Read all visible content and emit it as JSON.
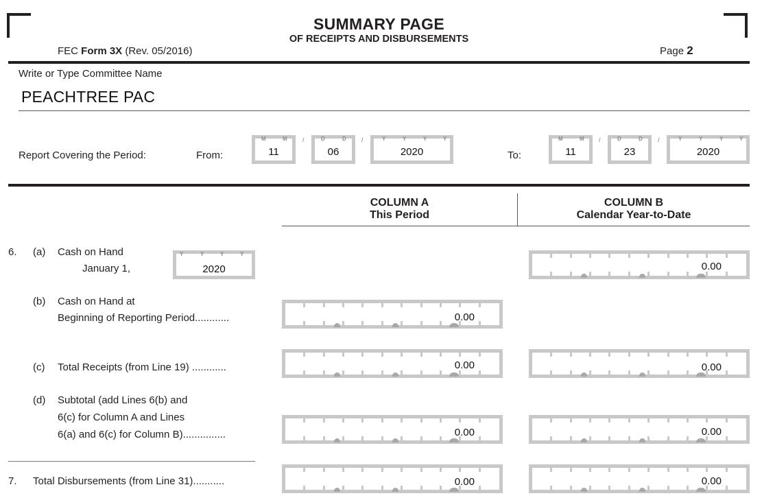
{
  "header": {
    "title": "SUMMARY PAGE",
    "subtitle": "OF RECEIPTS AND DISBURSEMENTS",
    "form_prefix": "FEC",
    "form_name": "Form 3X",
    "form_rev": "(Rev. 05/2016)",
    "page_label": "Page",
    "page_number": "2"
  },
  "committee": {
    "label": "Write or Type Committee Name",
    "name": "PEACHTREE PAC"
  },
  "period": {
    "label": "Report Covering the Period:",
    "from_label": "From:",
    "to_label": "To:",
    "from": {
      "month": "11",
      "day": "06",
      "year": "2020"
    },
    "to": {
      "month": "11",
      "day": "23",
      "year": "2020"
    },
    "hints": {
      "month": [
        "M",
        "M"
      ],
      "day": [
        "D",
        "D"
      ],
      "year": [
        "Y",
        "Y",
        "Y",
        "Y"
      ],
      "separator": "/"
    }
  },
  "columns": {
    "a": {
      "title": "COLUMN A",
      "subtitle": "This Period"
    },
    "b": {
      "title": "COLUMN B",
      "subtitle": "Calendar Year-to-Date"
    }
  },
  "lines": {
    "l6_number": "6.",
    "l6a": {
      "letter": "(a)",
      "text1": "Cash on Hand",
      "text2": "January 1,",
      "year": "2020",
      "col_b": "0.00"
    },
    "l6b": {
      "letter": "(b)",
      "text1": "Cash on Hand at",
      "text2": "Beginning of Reporting Period............",
      "col_a": "0.00"
    },
    "l6c": {
      "letter": "(c)",
      "text1": "Total Receipts (from Line 19) ............",
      "col_a": "0.00",
      "col_b": "0.00"
    },
    "l6d": {
      "letter": "(d)",
      "text1": "Subtotal (add Lines 6(b) and",
      "text2": "6(c) for Column A and Lines",
      "text3": "6(a) and 6(c) for Column B)...............",
      "col_a": "0.00",
      "col_b": "0.00"
    },
    "l7": {
      "number": "7.",
      "text1": "Total Disbursements (from Line 31)...........",
      "col_a": "0.00",
      "col_b": "0.00"
    }
  }
}
